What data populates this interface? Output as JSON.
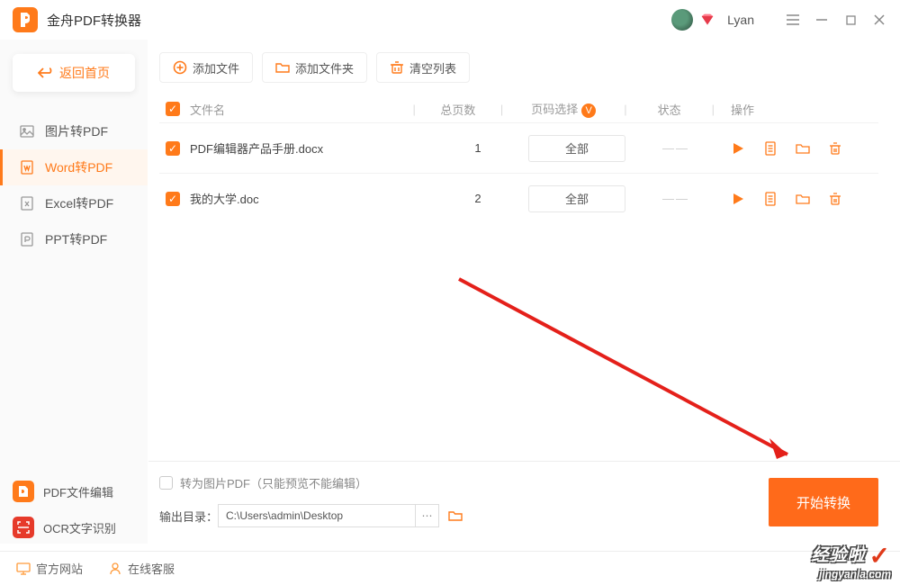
{
  "app": {
    "title": "金舟PDF转换器",
    "username": "Lyan"
  },
  "sidebar": {
    "back_label": "返回首页",
    "items": [
      {
        "label": "图片转PDF"
      },
      {
        "label": "Word转PDF"
      },
      {
        "label": "Excel转PDF"
      },
      {
        "label": "PPT转PDF"
      }
    ],
    "bottom": [
      {
        "label": "PDF文件编辑"
      },
      {
        "label": "OCR文字识别"
      }
    ]
  },
  "toolbar": {
    "add_file": "添加文件",
    "add_folder": "添加文件夹",
    "clear": "清空列表"
  },
  "columns": {
    "name": "文件名",
    "pages": "总页数",
    "range": "页码选择",
    "status": "状态",
    "ops": "操作"
  },
  "rows": [
    {
      "name": "PDF编辑器产品手册.docx",
      "pages": "1",
      "range": "全部",
      "status": "—— "
    },
    {
      "name": "我的大学.doc",
      "pages": "2",
      "range": "全部",
      "status": "—— "
    }
  ],
  "bottom": {
    "img_pdf_label": "转为图片PDF（只能预览不能编辑）",
    "output_label": "输出目录：",
    "output_path": "C:\\Users\\admin\\Desktop",
    "start_label": "开始转换"
  },
  "footer": {
    "site": "官方网站",
    "support": "在线客服"
  },
  "watermark": {
    "l1": "经验啦",
    "l2": "jingyanla.com"
  }
}
